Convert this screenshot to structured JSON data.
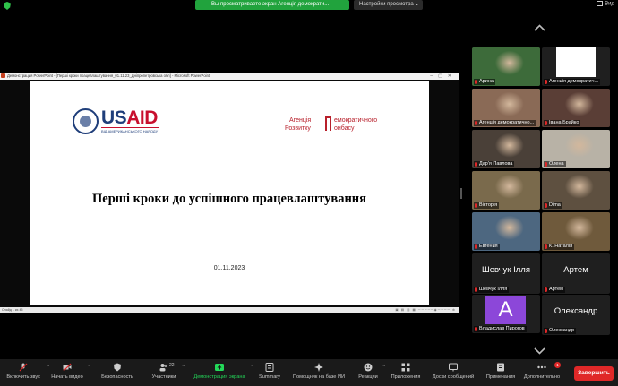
{
  "top": {
    "banner": "Вы просматриваете экран Агенція демократи...",
    "view_options": "Настройки просмотра",
    "view_button": "Вид"
  },
  "powerpoint": {
    "title": "Демонстрация PowerPoint - [Перші кроки працевлаштування_01.11.23_Дніпропетровська обл] - Microsoft PowerPoint",
    "status_left": "Слайд 1 из 45",
    "status_right": "▣ ▤ ▥ ▦ ─────◉──── ⊕"
  },
  "slide": {
    "usaid_left": "US",
    "usaid_right": "AID",
    "usaid_sub": "ВІД АМЕРИКАНСЬКОГО НАРОДУ",
    "agency_l1": "Агенція",
    "agency_l2": "Розвитку",
    "agency_r1": "емократичного",
    "agency_r2": "онбасу",
    "title": "Перші кроки до успішного працевлаштування",
    "date": "01.11.2023"
  },
  "participants": [
    {
      "name": "Арина",
      "kind": "video",
      "color": "#3d6b3a"
    },
    {
      "name": "Агенція демократич...",
      "kind": "logo",
      "color": "#ffffff"
    },
    {
      "name": "Агенція демократично...",
      "kind": "video",
      "color": "#8a6a56",
      "active": true
    },
    {
      "name": "Івана Брайко",
      "kind": "video",
      "color": "#5a3e36"
    },
    {
      "name": "Дар'я Павлова",
      "kind": "video",
      "color": "#4a4038"
    },
    {
      "name": "Олена",
      "kind": "video",
      "color": "#b8b2a6"
    },
    {
      "name": "Вікторія",
      "kind": "video",
      "color": "#7a6a4c"
    },
    {
      "name": "Dima",
      "kind": "video",
      "color": "#5e5040"
    },
    {
      "name": "Евгения",
      "kind": "video",
      "color": "#4d6780"
    },
    {
      "name": "К. Наталія",
      "kind": "video",
      "color": "#6f5a3c"
    },
    {
      "name": "Шевчук Ілля",
      "kind": "text",
      "big": "Шевчук Ілля"
    },
    {
      "name": "Артем",
      "kind": "text",
      "big": "Артем"
    },
    {
      "name": "Владислав Пирогов",
      "kind": "avatar",
      "letter": "A"
    },
    {
      "name": "Олександр",
      "kind": "text",
      "big": "Олександр"
    }
  ],
  "toolbar": {
    "mute": "Включить звук",
    "video": "Начать видео",
    "security": "Безопасность",
    "participants": "Участники",
    "participants_count": "22",
    "share": "Демонстрация экрана",
    "summary": "Summary",
    "assistant": "Помощник на базе ИИ",
    "reactions": "Реакции",
    "apps": "Приложения",
    "whiteboards": "Доски сообщений",
    "notes": "Примечания",
    "more": "Дополнительно",
    "more_badge": "1",
    "end": "Завершить"
  }
}
